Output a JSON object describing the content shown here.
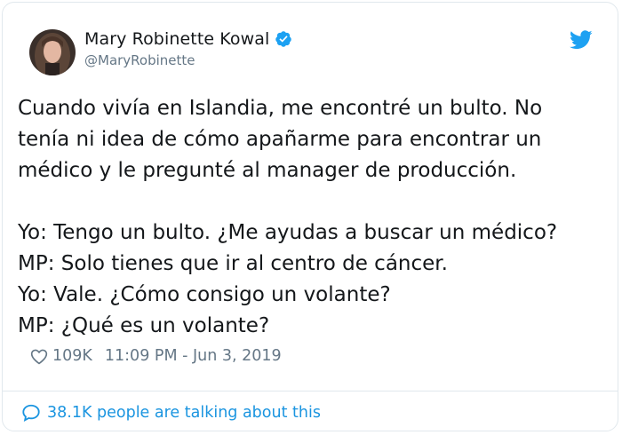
{
  "author": {
    "display_name": "Mary Robinette Kowal",
    "handle": "@MaryRobinette",
    "verified": true
  },
  "tweet": {
    "lines": [
      "Cuando vivía en Islandia, me encontré un bulto. No",
      "tenía ni idea de cómo apañarme para encontrar un",
      "médico y le pregunté al manager de producción.",
      "",
      "Yo: Tengo un bulto. ¿Me ayudas a buscar un médico?",
      "MP: Solo tienes que ir al centro de cáncer.",
      "Yo: Vale. ¿Cómo consigo un volante?",
      "MP: ¿Qué es un volante?"
    ]
  },
  "meta": {
    "likes": "109K",
    "timestamp": "11:09 PM - Jun 3, 2019"
  },
  "conversation": {
    "label": "38.1K people are talking about this"
  },
  "icons": {
    "verified": "verified-badge-icon",
    "brand": "twitter-bird-icon",
    "like": "heart-icon",
    "conversation": "speech-bubble-icon"
  },
  "colors": {
    "brand_blue": "#1da1f2",
    "link_blue": "#1b95e0",
    "text": "#14171a",
    "muted": "#657786"
  }
}
